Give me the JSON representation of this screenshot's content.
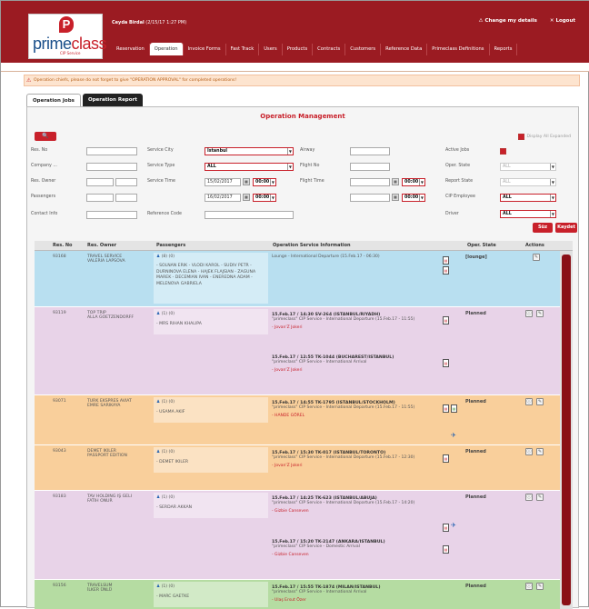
{
  "brand": {
    "name_a": "prime",
    "name_b": "class",
    "tagline": "CIP Service"
  },
  "user": {
    "name": "Ceyda Birdal",
    "datetime": "(2/15/17 1:27 PM)"
  },
  "top_links": [
    "Change my details",
    "Logout"
  ],
  "nav": [
    "Reservation",
    "Operation",
    "Invoice Forms",
    "Fast Track",
    "Users",
    "Products",
    "Contracts",
    "Customers",
    "Reference Data",
    "Primeclass Definitions",
    "Reports"
  ],
  "nav_active": "Operation",
  "warning": "Operation chiefs, please do not forget to give \"OPERATION APPROVAL\" for completed operations!",
  "tabs": [
    "Operation Jobs",
    "Operation Report"
  ],
  "title": "Operation Management",
  "display_all": "Display All Expanded",
  "filters": {
    "res_no": "Res. No",
    "company": "Company ...",
    "res_owner": "Res. Owner",
    "passengers": "Passengers",
    "contact": "Contact Info",
    "service_city": "Service City",
    "service_city_val": "İstanbul",
    "service_type": "Service Type",
    "service_type_val": "ALL",
    "service_time": "Service Time",
    "date_from": "15/02/2017",
    "time_from": "00:00",
    "date_to": "16/02/2017",
    "time_to": "00:00",
    "ref_code": "Reference Code",
    "airway": "Airway",
    "flight_no": "Flight No",
    "flight_time": "Flight Time",
    "ft_time_from": "00:00",
    "ft_time_to": "00:00",
    "active_jobs": "Active Jobs",
    "oper_state": "Oper. State",
    "oper_state_val": "ALL",
    "report_state": "Report State",
    "report_state_val": "ALL",
    "cip_employee": "CIP Employee",
    "cip_employee_val": "ALL",
    "driver": "Driver",
    "driver_val": "ALL",
    "btn_search": "Süz",
    "btn_save": "Kaydet"
  },
  "columns": [
    "Res. No",
    "Res. Owner",
    "Passengers",
    "Operation Service Information",
    "Oper. State",
    "Actions"
  ],
  "rows": [
    {
      "no": "93168",
      "owner": "TRAVEL SERVICE",
      "owner2": "VALERIA LAPSOVA",
      "pax": "(8)   (0)",
      "pax_names": "- SOLNAN ERIK - VLODI KAROL - SUDIV PETR - DURNINOVA ELENA - HAJEK FLAJSIAN - ZAGUNA MAREK - DECEMIAN IVAN - ENEREDNA ADAM - MELENOVA GABRIELA",
      "ops": [
        {
          "line": "",
          "sub": "Lounge - International Departure (15.Feb.17 - 06:30)",
          "guide": ""
        }
      ],
      "state": "[lounge]",
      "color": "#b8dff0"
    },
    {
      "no": "93119",
      "owner": "TOP TRIP",
      "owner2": "ALLA GOETZENDORFF",
      "pax": "(1)   (0)",
      "pax_names": "- MRS RIHAN KHALIPA",
      "ops": [
        {
          "line": "15.Feb.17 / 14:30 SV-264 (ISTANBUL/RIYADH)",
          "sub": "\"primeclass\" CIP Service - International Departure (15.Feb.17 - 11:55)",
          "guide": "- Jovan'Z Jokeri"
        },
        {
          "line": "15.Feb.17 / 12:55 TK-1044 (BUCHAREST/ISTANBUL)",
          "sub": "\"primeclass\" CIP Service - International Arrival",
          "guide": "- Jovan'Z Jokeri"
        }
      ],
      "state": "Planned",
      "color": "#e8d3e8"
    },
    {
      "no": "93071",
      "owner": "TURK EKSPRES AVIAT",
      "owner2": "EMRE SARIKAYA",
      "pax": "(1)   (0)",
      "pax_names": "- USAMA AKIF",
      "ops": [
        {
          "line": "15.Feb.17 / 14:55 TK-1795 (ISTANBUL/STOCKHOLM)",
          "sub": "\"primeclass\" CIP Service - International Departure (15.Feb.17 - 11:55)",
          "guide": "- HANDE GÖREL"
        }
      ],
      "state": "Planned",
      "color": "#f9cf9b"
    },
    {
      "no": "93043",
      "owner": "DEMET IKILER",
      "owner2": "PASSPORT EDITION",
      "pax": "(1)   (0)",
      "pax_names": "- DEMET IKILER",
      "ops": [
        {
          "line": "15.Feb.17 / 15:30 TK-017 (ISTANBUL/TORONTO)",
          "sub": "\"primeclass\" CIP Service - International Departure (15.Feb.17 - 12:30)",
          "guide": "- Jovan'Z Jokeri"
        }
      ],
      "state": "Planned",
      "color": "#f9cf9b"
    },
    {
      "no": "93183",
      "owner": "TAV HOLDING IŞ GELI",
      "owner2": "FATIH ONUR",
      "pax": "(1)   (0)",
      "pax_names": "- SERDAR AKKAN",
      "ops": [
        {
          "line": "15.Feb.17 / 14:25 TK-623 (ISTANBUL/ABUJA)",
          "sub": "\"primeclass\" CIP Service - International Departure (15.Feb.17 - 14:20)",
          "guide": "- Gizbie Canseven"
        },
        {
          "line": "15.Feb.17 / 15:20 TK-2147 (ANKARA/ISTANBUL)",
          "sub": "\"primeclass\" CIP Service - Domestic Arrival",
          "guide": "- Gizbie Canseven"
        }
      ],
      "state": "Planned",
      "color": "#e8d3e8"
    },
    {
      "no": "93156",
      "owner": "TRAVELSUM",
      "owner2": "İLKER ÜNLÜ",
      "pax": "(1)   (0)",
      "pax_names": "- MARC GAETKE",
      "ops": [
        {
          "line": "15.Feb.17 / 15:55 TK-1874 (MILAN/ISTANBUL)",
          "sub": "\"primeclass\" CIP Service - International Arrival",
          "guide": "- Ulaş Ersut Özer"
        }
      ],
      "state": "Planned",
      "color": "#b5dca2"
    }
  ],
  "colors": {
    "brand": "#9b1b22",
    "accent": "#c8202a",
    "lounge": "#b8dff0",
    "planned": "#e8d3e8",
    "orange": "#f9cf9b",
    "green": "#b5dca2"
  }
}
